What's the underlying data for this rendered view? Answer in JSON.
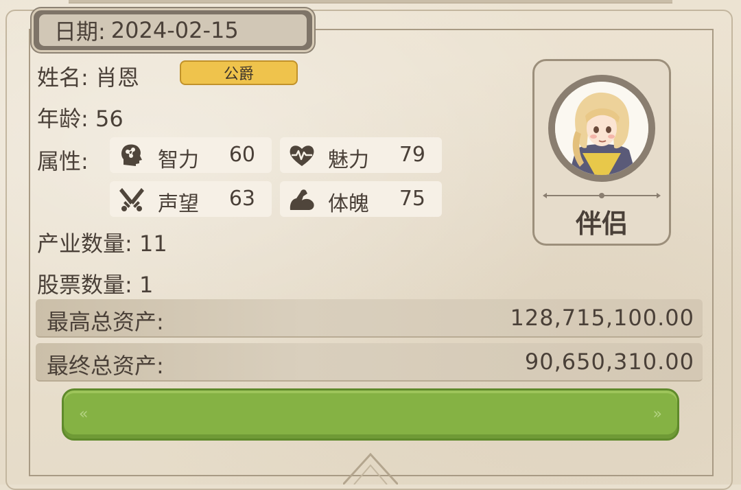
{
  "date": {
    "label": "日期:",
    "value": "2024-02-15"
  },
  "profile": {
    "name_label": "姓名:",
    "name": "肖恩",
    "title_badge": "公爵",
    "age_label": "年龄:",
    "age": "56",
    "attributes_label": "属性:",
    "attributes": [
      {
        "name": "智力",
        "value": "60",
        "icon": "brain-head-icon"
      },
      {
        "name": "魅力",
        "value": "79",
        "icon": "heartbeat-icon"
      },
      {
        "name": "声望",
        "value": "63",
        "icon": "crossed-swords-icon"
      },
      {
        "name": "体魄",
        "value": "75",
        "icon": "flexed-arm-icon"
      }
    ],
    "industry_label": "产业数量:",
    "industry_count": "11",
    "stock_label": "股票数量:",
    "stock_count": "1"
  },
  "assets": {
    "highest_label": "最高总资产:",
    "highest_value": "128,715,100.00",
    "final_label": "最终总资产:",
    "final_value": "90,650,310.00"
  },
  "partner": {
    "label": "伴侣"
  },
  "colors": {
    "accent_gold": "#efc34c",
    "button_green": "#85b244",
    "text": "#4a4038"
  }
}
